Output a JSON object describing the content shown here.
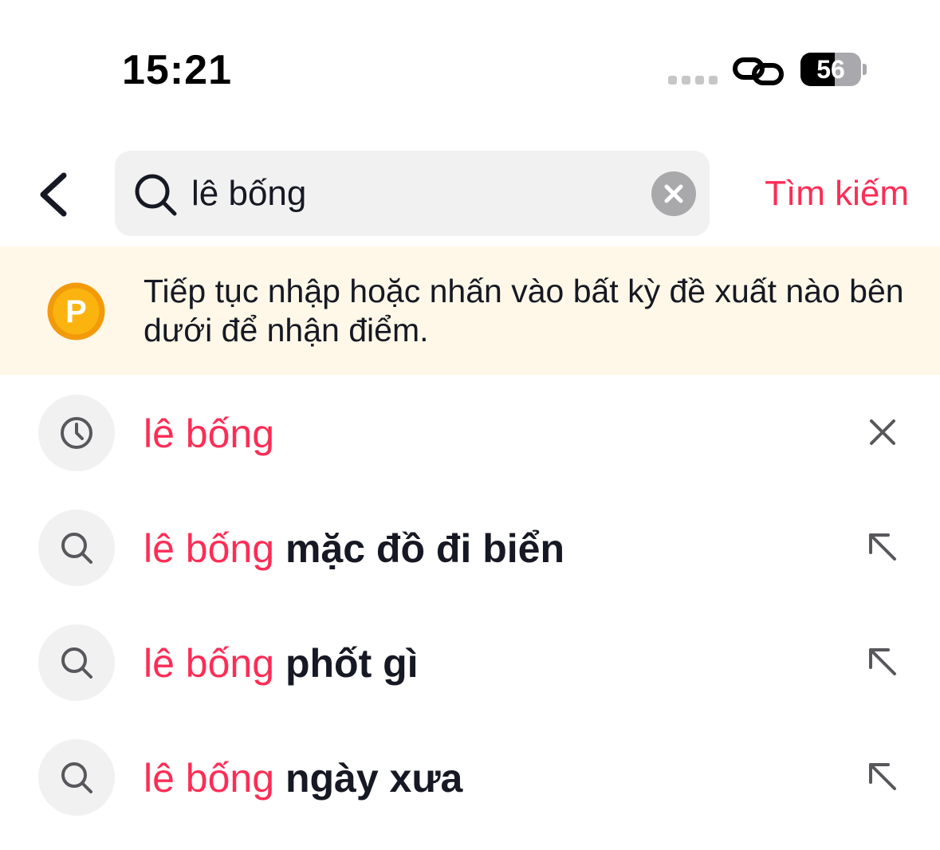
{
  "status_bar": {
    "time": "15:21",
    "battery_percent": 56,
    "battery_label": "56",
    "icons": [
      "signal-dots-icon",
      "link-icon",
      "battery-icon"
    ]
  },
  "header": {
    "back_icon": "chevron-left-icon",
    "search_icon": "search-icon",
    "search_value": "lê bống",
    "clear_icon": "clear-icon",
    "submit_label": "Tìm kiếm"
  },
  "banner": {
    "icon": "points-coin-icon",
    "coin_letter": "P",
    "text": "Tiếp tục nhập hoặc nhấn vào bất kỳ đề xuất nào bên dưới để nhận điểm."
  },
  "suggestions": [
    {
      "type": "history",
      "icon": "clock-icon",
      "highlight": "lê bống",
      "rest": "",
      "action_icon": "close-icon"
    },
    {
      "type": "suggestion",
      "icon": "search-icon",
      "highlight": "lê bống",
      "rest": " mặc đồ đi biển",
      "action_icon": "arrow-up-left-icon"
    },
    {
      "type": "suggestion",
      "icon": "search-icon",
      "highlight": "lê bống",
      "rest": " phốt gì",
      "action_icon": "arrow-up-left-icon"
    },
    {
      "type": "suggestion",
      "icon": "search-icon",
      "highlight": "lê bống",
      "rest": " ngày xưa",
      "action_icon": "arrow-up-left-icon"
    }
  ],
  "colors": {
    "accent": "#fe2c55",
    "banner_bg": "#fff8e8",
    "input_bg": "#f1f1f2",
    "coin": "#fbb40f"
  }
}
